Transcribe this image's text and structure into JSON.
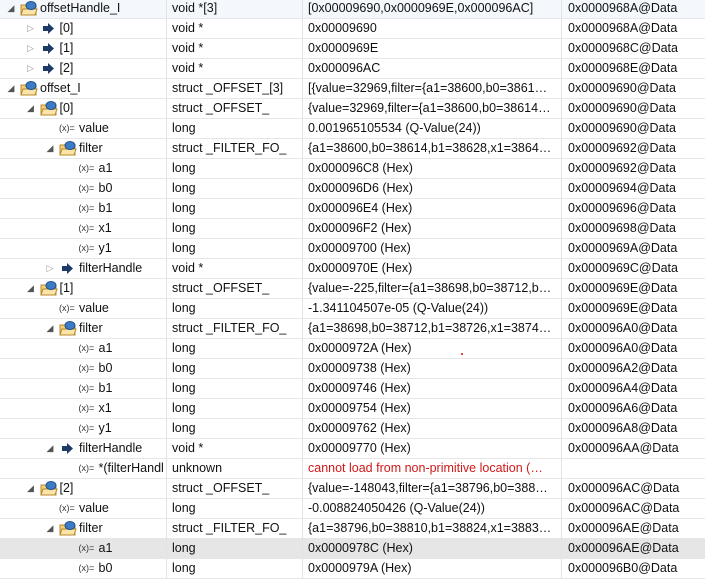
{
  "variables": [
    {
      "name": "offsetHandle_I",
      "type": "void *[3]",
      "value": "[0x00009690,0x0000969E,0x000096AC]",
      "location": "0x0000968A@Data",
      "level": 0,
      "icon": "struct-icon",
      "expander": "open"
    },
    {
      "name": "[0]",
      "type": "void *",
      "value": "0x00009690",
      "location": "0x0000968A@Data",
      "level": 1,
      "icon": "pointer-icon",
      "expander": "closed"
    },
    {
      "name": "[1]",
      "type": "void *",
      "value": "0x0000969E",
      "location": "0x0000968C@Data",
      "level": 1,
      "icon": "pointer-icon",
      "expander": "closed"
    },
    {
      "name": "[2]",
      "type": "void *",
      "value": "0x000096AC",
      "location": "0x0000968E@Data",
      "level": 1,
      "icon": "pointer-icon",
      "expander": "closed"
    },
    {
      "name": "offset_I",
      "type": "struct _OFFSET_[3]",
      "value": "[{value=32969,filter={a1=38600,b0=3861…",
      "location": "0x00009690@Data",
      "level": 0,
      "icon": "struct-icon",
      "expander": "open"
    },
    {
      "name": "[0]",
      "type": "struct _OFFSET_",
      "value": "{value=32969,filter={a1=38600,b0=38614…",
      "location": "0x00009690@Data",
      "level": 1,
      "icon": "struct-icon",
      "expander": "open"
    },
    {
      "name": "value",
      "type": "long",
      "value": "0.001965105534 (Q-Value(24))",
      "location": "0x00009690@Data",
      "level": 2,
      "icon": "variable-icon",
      "expander": "none"
    },
    {
      "name": "filter",
      "type": "struct _FILTER_FO_",
      "value": "{a1=38600,b0=38614,b1=38628,x1=3864…",
      "location": "0x00009692@Data",
      "level": 2,
      "icon": "struct-icon",
      "expander": "open"
    },
    {
      "name": "a1",
      "type": "long",
      "value": "0x000096C8 (Hex)",
      "location": "0x00009692@Data",
      "level": 3,
      "icon": "variable-icon",
      "expander": "none"
    },
    {
      "name": "b0",
      "type": "long",
      "value": "0x000096D6 (Hex)",
      "location": "0x00009694@Data",
      "level": 3,
      "icon": "variable-icon",
      "expander": "none"
    },
    {
      "name": "b1",
      "type": "long",
      "value": "0x000096E4 (Hex)",
      "location": "0x00009696@Data",
      "level": 3,
      "icon": "variable-icon",
      "expander": "none"
    },
    {
      "name": "x1",
      "type": "long",
      "value": "0x000096F2 (Hex)",
      "location": "0x00009698@Data",
      "level": 3,
      "icon": "variable-icon",
      "expander": "none"
    },
    {
      "name": "y1",
      "type": "long",
      "value": "0x00009700 (Hex)",
      "location": "0x0000969A@Data",
      "level": 3,
      "icon": "variable-icon",
      "expander": "none"
    },
    {
      "name": "filterHandle",
      "type": "void *",
      "value": "0x0000970E (Hex)",
      "location": "0x0000969C@Data",
      "level": 2,
      "icon": "pointer-icon",
      "expander": "closed"
    },
    {
      "name": "[1]",
      "type": "struct _OFFSET_",
      "value": "{value=-225,filter={a1=38698,b0=38712,b…",
      "location": "0x0000969E@Data",
      "level": 1,
      "icon": "struct-icon",
      "expander": "open"
    },
    {
      "name": "value",
      "type": "long",
      "value": "-1.341104507e-05 (Q-Value(24))",
      "location": "0x0000969E@Data",
      "level": 2,
      "icon": "variable-icon",
      "expander": "none"
    },
    {
      "name": "filter",
      "type": "struct _FILTER_FO_",
      "value": "{a1=38698,b0=38712,b1=38726,x1=3874…",
      "location": "0x000096A0@Data",
      "level": 2,
      "icon": "struct-icon",
      "expander": "open"
    },
    {
      "name": "a1",
      "type": "long",
      "value": "0x0000972A (Hex)",
      "location": "0x000096A0@Data",
      "level": 3,
      "icon": "variable-icon",
      "expander": "none"
    },
    {
      "name": "b0",
      "type": "long",
      "value": "0x00009738 (Hex)",
      "location": "0x000096A2@Data",
      "level": 3,
      "icon": "variable-icon",
      "expander": "none"
    },
    {
      "name": "b1",
      "type": "long",
      "value": "0x00009746 (Hex)",
      "location": "0x000096A4@Data",
      "level": 3,
      "icon": "variable-icon",
      "expander": "none"
    },
    {
      "name": "x1",
      "type": "long",
      "value": "0x00009754 (Hex)",
      "location": "0x000096A6@Data",
      "level": 3,
      "icon": "variable-icon",
      "expander": "none"
    },
    {
      "name": "y1",
      "type": "long",
      "value": "0x00009762 (Hex)",
      "location": "0x000096A8@Data",
      "level": 3,
      "icon": "variable-icon",
      "expander": "none"
    },
    {
      "name": "filterHandle",
      "type": "void *",
      "value": "0x00009770 (Hex)",
      "location": "0x000096AA@Data",
      "level": 2,
      "icon": "pointer-icon",
      "expander": "open"
    },
    {
      "name": "*(filterHandl",
      "type": "unknown",
      "value": "cannot load from non-primitive location (…",
      "location": "",
      "level": 3,
      "icon": "variable-icon",
      "expander": "none",
      "error": true
    },
    {
      "name": "[2]",
      "type": "struct _OFFSET_",
      "value": "{value=-148043,filter={a1=38796,b0=388…",
      "location": "0x000096AC@Data",
      "level": 1,
      "icon": "struct-icon",
      "expander": "open"
    },
    {
      "name": "value",
      "type": "long",
      "value": "-0.008824050426 (Q-Value(24))",
      "location": "0x000096AC@Data",
      "level": 2,
      "icon": "variable-icon",
      "expander": "none"
    },
    {
      "name": "filter",
      "type": "struct _FILTER_FO_",
      "value": "{a1=38796,b0=38810,b1=38824,x1=3883…",
      "location": "0x000096AE@Data",
      "level": 2,
      "icon": "struct-icon",
      "expander": "open"
    },
    {
      "name": "a1",
      "type": "long",
      "value": "0x0000978C (Hex)",
      "location": "0x000096AE@Data",
      "level": 3,
      "icon": "variable-icon",
      "expander": "none",
      "selected": true
    },
    {
      "name": "b0",
      "type": "long",
      "value": "0x0000979A (Hex)",
      "location": "0x000096B0@Data",
      "level": 3,
      "icon": "variable-icon",
      "expander": "none"
    }
  ],
  "colors": {
    "error": "#d11919",
    "selected": "#e6e6e6",
    "folder": "#f0c060",
    "pointer": "#1d3b66"
  }
}
